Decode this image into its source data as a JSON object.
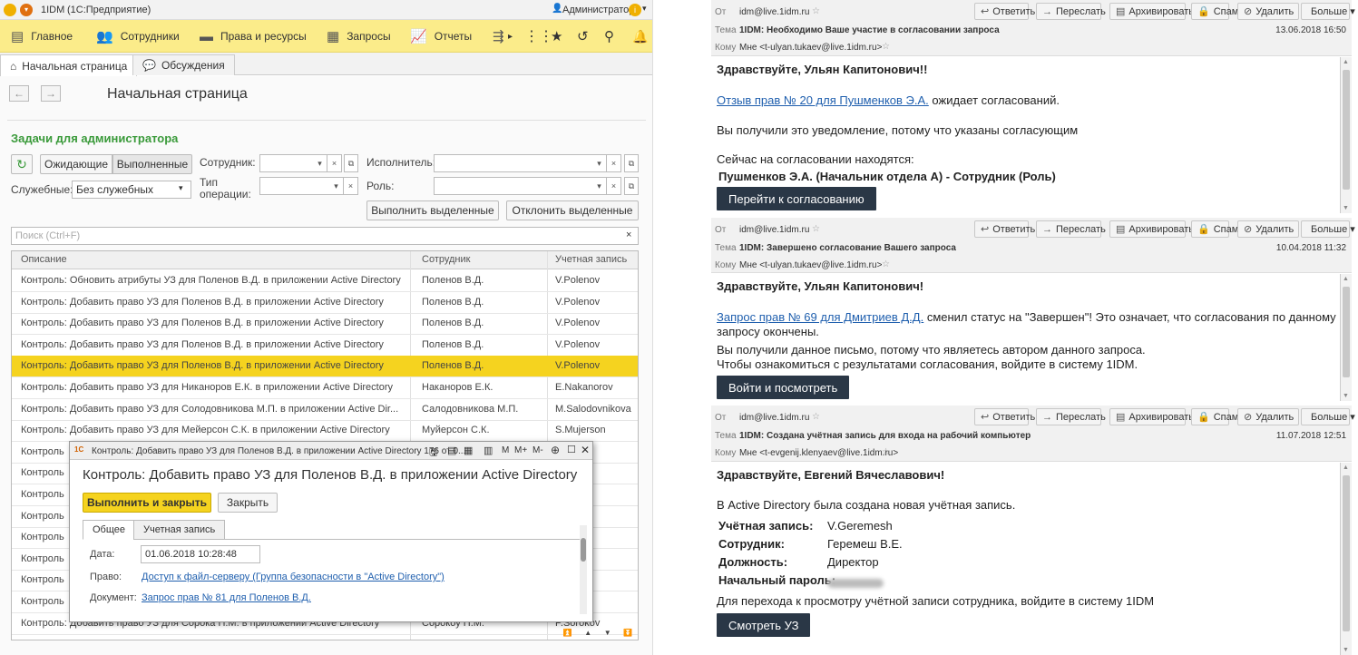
{
  "onec": {
    "window_title": "1IDM",
    "window_subtitle": "(1С:Предприятие)",
    "user": "Администратор",
    "menu": [
      "Главное",
      "Сотрудники",
      "Права и ресурсы",
      "Запросы",
      "Отчеты"
    ],
    "tabs": [
      "Начальная страница",
      "Обсуждения"
    ],
    "page_title": "Начальная страница",
    "section_title": "Задачи для администратора",
    "filters": {
      "waiting": "Ожидающие",
      "done": "Выполненные",
      "employee_label": "Сотрудник:",
      "executor_label": "Исполнитель:",
      "service_label": "Служебные:",
      "service_value": "Без служебных",
      "optype_label": "Тип операции:",
      "role_label": "Роль:",
      "execute_btn": "Выполнить выделенные",
      "reject_btn": "Отклонить выделенные",
      "search_placeholder": "Поиск (Ctrl+F)"
    },
    "columns": [
      "Описание",
      "Сотрудник",
      "Учетная запись"
    ],
    "rows": [
      {
        "desc": "Контроль: Обновить атрибуты УЗ для Поленов В.Д. в приложении Active Directory",
        "emp": "Поленов В.Д.",
        "acc": "V.Polenov"
      },
      {
        "desc": "Контроль: Добавить право УЗ для Поленов В.Д. в приложении Active Directory",
        "emp": "Поленов В.Д.",
        "acc": "V.Polenov"
      },
      {
        "desc": "Контроль: Добавить право УЗ для Поленов В.Д. в приложении Active Directory",
        "emp": "Поленов В.Д.",
        "acc": "V.Polenov"
      },
      {
        "desc": "Контроль: Добавить право УЗ для Поленов В.Д. в приложении Active Directory",
        "emp": "Поленов В.Д.",
        "acc": "V.Polenov"
      },
      {
        "desc": "Контроль: Добавить право УЗ для Поленов В.Д. в приложении Active Directory",
        "emp": "Поленов В.Д.",
        "acc": "V.Polenov"
      },
      {
        "desc": "Контроль: Добавить право УЗ для Никаноров Е.К. в приложении Active Directory",
        "emp": "Наканоров Е.К.",
        "acc": "E.Nakanorov"
      },
      {
        "desc": "Контроль: Добавить право УЗ для Солодовникова М.П. в приложении Active Dir...",
        "emp": "Салодовникова М.П.",
        "acc": "M.Salodovnikova"
      },
      {
        "desc": "Контроль: Добавить право УЗ для Мейерсон С.К. в приложении Active Directory",
        "emp": "Муйерсон С.К.",
        "acc": "S.Mujerson"
      },
      {
        "desc": "Контроль",
        "emp": "",
        "acc": "va"
      },
      {
        "desc": "Контроль",
        "emp": "",
        "acc": "va"
      },
      {
        "desc": "Контроль",
        "emp": "",
        "acc": "vskaya"
      },
      {
        "desc": "Контроль",
        "emp": "",
        "acc": "nykh"
      },
      {
        "desc": "Контроль",
        "emp": "",
        "acc": "kova"
      },
      {
        "desc": "Контроль",
        "emp": "",
        "acc": "va"
      },
      {
        "desc": "Контроль",
        "emp": "",
        "acc": "tkina"
      },
      {
        "desc": "Контроль",
        "emp": "",
        "acc": "nyuk"
      },
      {
        "desc": "Контроль: Добавить право УЗ для Сорока П.М. в приложении Active Directory",
        "emp": "Сорокоу П.М.",
        "acc": "P.Sorokov"
      }
    ],
    "popup": {
      "title_bar": "Контроль: Добавить право УЗ для Поленов В.Д. в приложении Active Directory 176 от 0...",
      "heading": "Контроль: Добавить право УЗ для Поленов В.Д. в приложении Active Directory",
      "exec_close": "Выполнить и закрыть",
      "close": "Закрыть",
      "tab_general": "Общее",
      "tab_account": "Учетная запись",
      "date_label": "Дата:",
      "date_value": "01.06.2018 10:28:48",
      "right_label": "Право:",
      "right_value": "Доступ к файл-серверу (Группа безопасности в \"Active Directory\")",
      "doc_label": "Документ:",
      "doc_value": "Запрос прав № 81 для Поленов В.Д.",
      "m_labels": [
        "M",
        "M+",
        "M-"
      ]
    }
  },
  "mail": {
    "labels": {
      "from": "От",
      "subject": "Тема",
      "to": "Кому"
    },
    "buttons": [
      "Ответить",
      "Переслать",
      "Архивировать",
      "Спам",
      "Удалить",
      "Больше"
    ],
    "messages": [
      {
        "from": "idm@live.1idm.ru",
        "subject": "1IDM: Необходимо Ваше участие в согласовании запроса",
        "date": "13.06.2018 16:50",
        "to": "Мне <t-ulyan.tukaev@live.1idm.ru>",
        "greeting": "Здравствуйте, Ульян Капитонович!!",
        "link": "Отзыв прав № 20 для Пушменков Э.А.",
        "link_rest": " ожидает согласований.",
        "p1": "Вы получили это уведомление, потому что указаны согласующим",
        "p2": "Сейчас на согласовании находятся:",
        "p3": "Пушменков Э.А. (Начальник отдела А) - Сотрудник (Роль)",
        "button": "Перейти к согласованию"
      },
      {
        "from": "idm@live.1idm.ru",
        "subject": "1IDM: Завершено согласование Вашего запроса",
        "date": "10.04.2018 11:32",
        "to": "Мне <t-ulyan.tukaev@live.1idm.ru>",
        "greeting": "Здравствуйте, Ульян Капитонович!",
        "link": "Запрос прав № 69 для Дмитриев Д.Д.",
        "link_rest": " сменил статус на \"Завершен\"! Это означает, что согласования по данному",
        "link_rest2": "запросу окончены.",
        "p1": "Вы получили данное письмо, потому что являетесь автором данного запроса.",
        "p2": "Чтобы ознакомиться с результатами согласования, войдите в систему 1IDM.",
        "button": "Войти и посмотреть"
      },
      {
        "from": "idm@live.1idm.ru",
        "subject": "1IDM: Создана учётная запись для входа на рабочий компьютер",
        "date": "11.07.2018 12:51",
        "to": "Мне <t-evgenij.klenyaev@live.1idm.ru>",
        "greeting": "Здравствуйте, Евгений Вячеславович!",
        "p1": "В Active Directory была создана новая учётная запись.",
        "fields": [
          {
            "label": "Учётная запись:",
            "value": "V.Geremesh"
          },
          {
            "label": "Сотрудник:",
            "value": "Геремеш В.Е."
          },
          {
            "label": "Должность:",
            "value": "Директор"
          },
          {
            "label": "Начальный пароль:",
            "value": ""
          }
        ],
        "p2": "Для перехода к просмотру учётной записи сотрудника, войдите в систему 1IDM",
        "button": "Смотреть УЗ"
      }
    ]
  }
}
